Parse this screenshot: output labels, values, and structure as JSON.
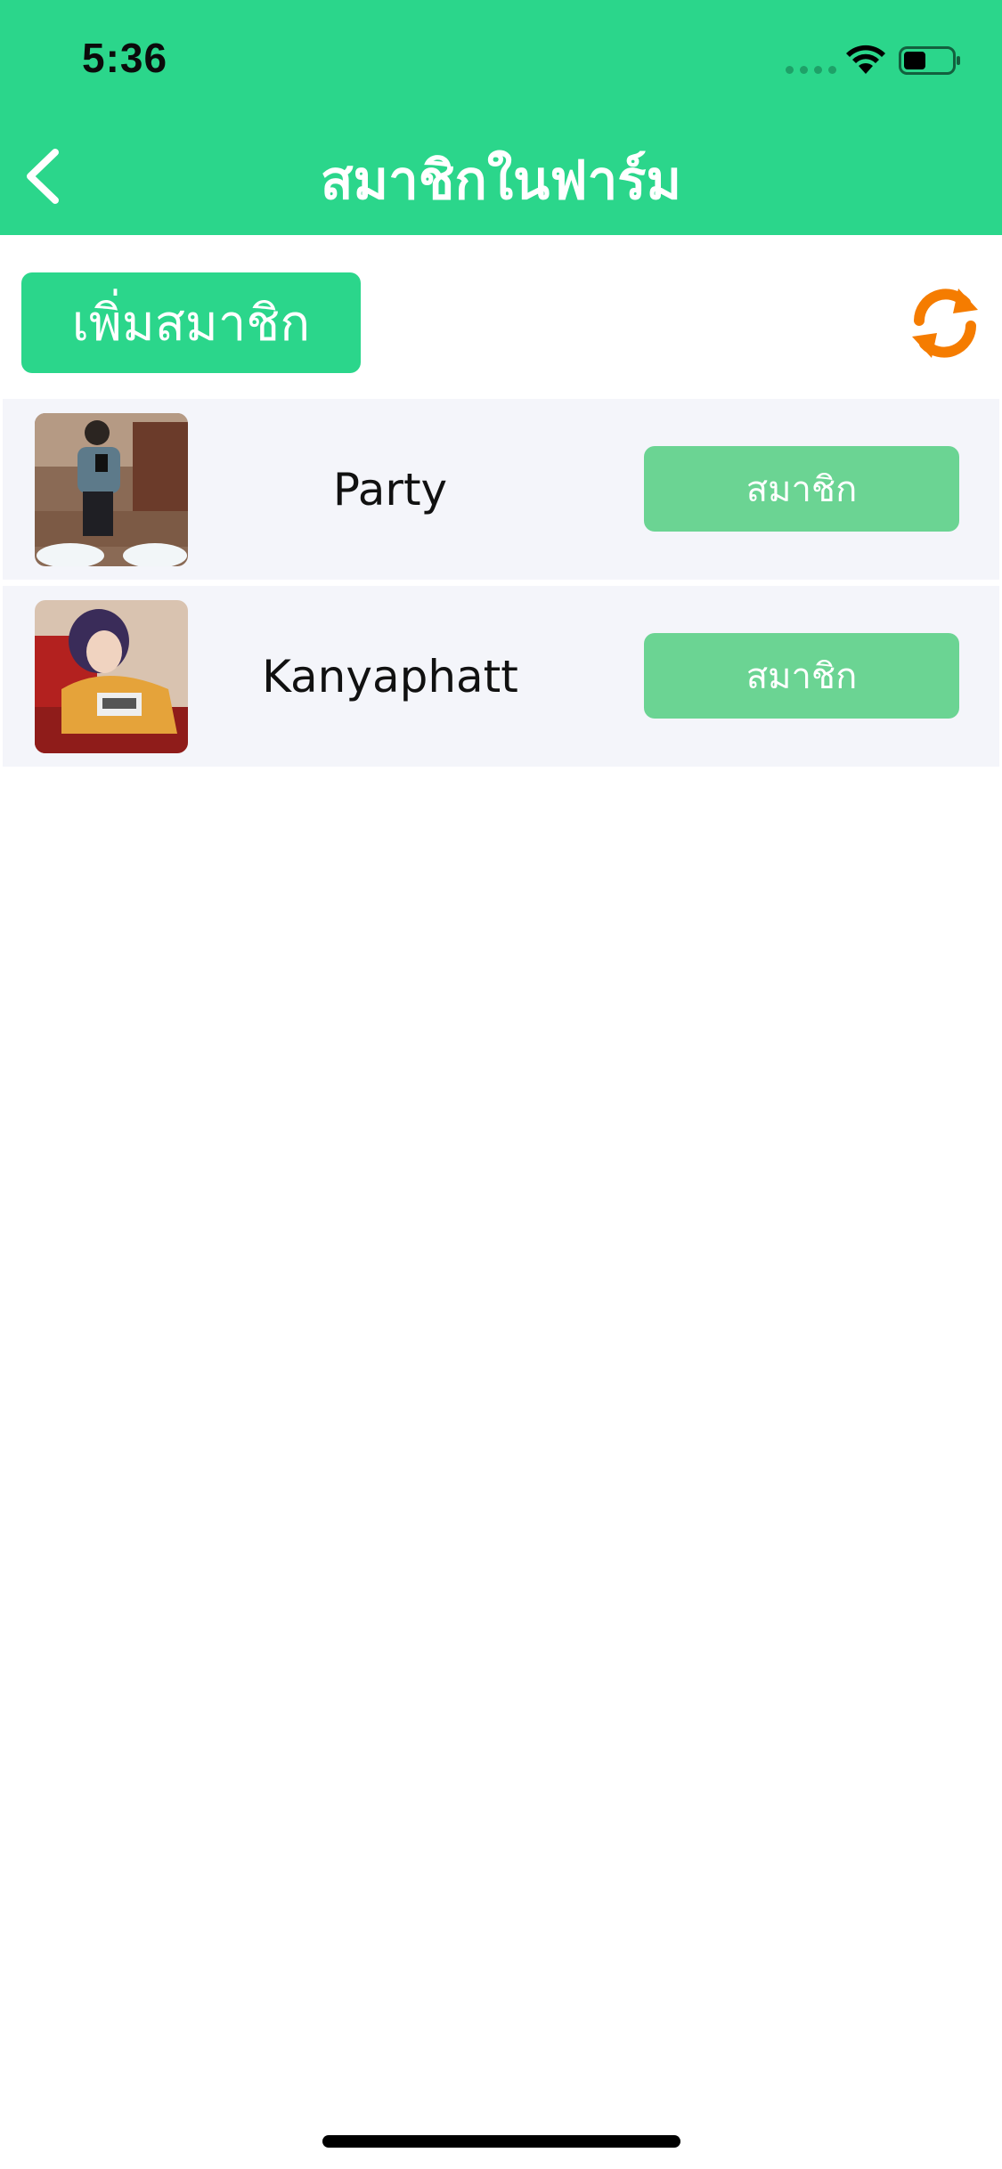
{
  "status_bar": {
    "time": "5:36"
  },
  "header": {
    "title": "สมาชิกในฟาร์ม",
    "back_icon": "chevron-left-icon",
    "background_color": "#2bd68b"
  },
  "toolbar": {
    "add_member_label": "เพิ่มสมาชิก",
    "refresh_icon": "refresh-icon",
    "refresh_color": "#f57c00"
  },
  "members": [
    {
      "name": "Party",
      "role_label": "สมาชิก"
    },
    {
      "name": "Kanyaphatt",
      "role_label": "สมาชิก"
    }
  ]
}
